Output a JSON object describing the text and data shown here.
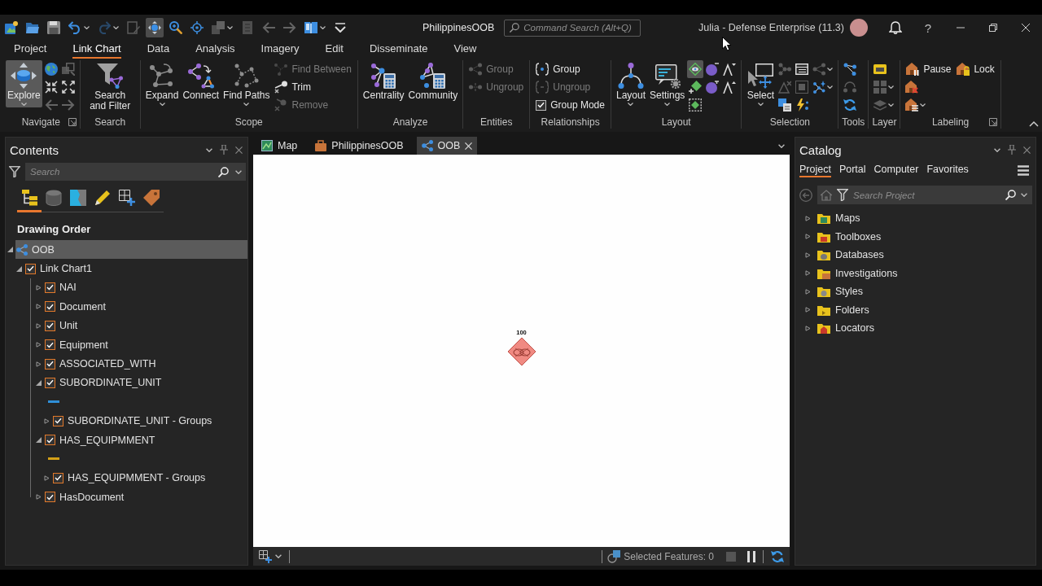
{
  "title_bar": {
    "quick_access": [
      {
        "selected": false,
        "disabled": false
      },
      {
        "selected": false,
        "disabled": false
      },
      {
        "selected": false,
        "disabled": false
      },
      {
        "selected": false,
        "disabled": false,
        "dropdown": true
      },
      {
        "selected": false,
        "disabled": true,
        "dropdown": true
      },
      {
        "selected": false,
        "disabled": true
      },
      {
        "selected": true,
        "disabled": false
      },
      {
        "selected": false,
        "disabled": false
      },
      {
        "selected": false,
        "disabled": false
      },
      {
        "selected": false,
        "disabled": true,
        "dropdown": true
      },
      {
        "selected": false,
        "disabled": true
      },
      {
        "selected": false,
        "disabled": true
      },
      {
        "selected": false,
        "disabled": true
      },
      {
        "selected": false,
        "disabled": false,
        "dropdown": true
      },
      {
        "selected": false,
        "disabled": false
      }
    ],
    "title": "PhilippinesOOB",
    "command_search": {
      "placeholder": "Command Search (Alt+Q)"
    },
    "user": "Julia - Defense Enterprise (11.3)",
    "help": "?"
  },
  "ribbon": {
    "tabs": [
      {
        "label": "Project",
        "selected": false
      },
      {
        "label": "Link Chart",
        "selected": true
      },
      {
        "label": "Data",
        "selected": false
      },
      {
        "label": "Analysis",
        "selected": false
      },
      {
        "label": "Imagery",
        "selected": false
      },
      {
        "label": "Edit",
        "selected": false
      },
      {
        "label": "Disseminate",
        "selected": false
      },
      {
        "label": "View",
        "selected": false
      }
    ],
    "groups": [
      {
        "label": "Navigate",
        "launcher": true,
        "stacks": [
          [
            {
              "kind": "large",
              "label": "Explore",
              "selected": true,
              "disabled": false,
              "dropdown": true
            }
          ],
          [
            {
              "kind": "icon",
              "selected": false,
              "disabled": false
            },
            {
              "kind": "icon",
              "selected": false,
              "disabled": false
            },
            {
              "kind": "icon",
              "selected": false,
              "disabled": true
            }
          ],
          [
            {
              "kind": "icon",
              "selected": false,
              "disabled": true
            },
            {
              "kind": "icon",
              "selected": false,
              "disabled": false
            },
            {
              "kind": "icon",
              "selected": false,
              "disabled": true
            }
          ]
        ]
      },
      {
        "label": "Search",
        "launcher": false,
        "stacks": [
          [
            {
              "kind": "large",
              "label": "Search and Filter",
              "selected": false,
              "disabled": false
            }
          ]
        ]
      },
      {
        "label": "Scope",
        "launcher": false,
        "stacks": [
          [
            {
              "kind": "large",
              "label": "Expand",
              "selected": false,
              "disabled": false,
              "dropdown": true
            }
          ],
          [
            {
              "kind": "large",
              "label": "Connect",
              "selected": false,
              "disabled": false
            }
          ],
          [
            {
              "kind": "large",
              "label": "Find Paths",
              "selected": false,
              "disabled": false,
              "dropdown": true
            }
          ],
          [
            {
              "kind": "small",
              "label": "Find Between",
              "selected": false,
              "disabled": true
            },
            {
              "kind": "small",
              "label": "Trim",
              "selected": false,
              "disabled": false
            },
            {
              "kind": "small",
              "label": "Remove",
              "selected": false,
              "disabled": true
            }
          ]
        ]
      },
      {
        "label": "Analyze",
        "launcher": false,
        "stacks": [
          [
            {
              "kind": "large",
              "label": "Centrality",
              "selected": false,
              "disabled": false
            }
          ],
          [
            {
              "kind": "large",
              "label": "Community",
              "selected": false,
              "disabled": false
            }
          ]
        ]
      },
      {
        "label": "Entities",
        "launcher": false,
        "stacks": [
          [
            {
              "kind": "small",
              "label": "Group",
              "selected": false,
              "disabled": true
            },
            {
              "kind": "small",
              "label": "Ungroup",
              "selected": false,
              "disabled": true
            }
          ]
        ]
      },
      {
        "label": "Relationships",
        "launcher": false,
        "stacks": [
          [
            {
              "kind": "small",
              "label": "Group",
              "selected": false,
              "disabled": false
            },
            {
              "kind": "small",
              "label": "Ungroup",
              "selected": false,
              "disabled": true
            },
            {
              "kind": "check",
              "label": "Group Mode",
              "checked": true
            }
          ]
        ]
      },
      {
        "label": "Layout",
        "launcher": false,
        "stacks": [
          [
            {
              "kind": "large",
              "label": "Layout",
              "selected": false,
              "disabled": false,
              "dropdown": true
            }
          ],
          [
            {
              "kind": "large",
              "label": "Settings",
              "selected": false,
              "disabled": false,
              "dropdown": true
            }
          ],
          [
            {
              "kind": "icon",
              "selected": true,
              "disabled": false
            },
            {
              "kind": "icon",
              "selected": false,
              "disabled": false
            },
            {
              "kind": "icon",
              "selected": false,
              "disabled": false
            }
          ],
          [
            {
              "kind": "icon",
              "selected": false,
              "disabled": false
            },
            {
              "kind": "icon",
              "selected": false,
              "disabled": false
            }
          ],
          [
            {
              "kind": "icon",
              "selected": false,
              "disabled": false
            },
            {
              "kind": "icon",
              "selected": false,
              "disabled": false
            }
          ]
        ]
      },
      {
        "label": "Selection",
        "launcher": false,
        "stacks": [
          [
            {
              "kind": "large",
              "label": "Select",
              "selected": false,
              "disabled": false,
              "dropdown": true
            }
          ],
          [
            {
              "kind": "icon",
              "selected": false,
              "disabled": true
            },
            {
              "kind": "icon",
              "selected": false,
              "disabled": true
            },
            {
              "kind": "icon",
              "selected": false,
              "disabled": false
            }
          ],
          [
            {
              "kind": "icon",
              "selected": false,
              "disabled": false
            },
            {
              "kind": "icon",
              "selected": false,
              "disabled": true
            },
            {
              "kind": "icon",
              "selected": false,
              "disabled": false
            }
          ],
          [
            {
              "kind": "icon",
              "selected": false,
              "disabled": true,
              "dropdown": true
            },
            {
              "kind": "icon",
              "selected": false,
              "disabled": false,
              "dropdown": true
            }
          ]
        ]
      },
      {
        "label": "Tools",
        "launcher": false,
        "stacks": [
          [
            {
              "kind": "icon",
              "selected": false,
              "disabled": false
            },
            {
              "kind": "icon",
              "selected": false,
              "disabled": true
            },
            {
              "kind": "icon",
              "selected": false,
              "disabled": false
            }
          ]
        ]
      },
      {
        "label": "Layer",
        "launcher": false,
        "stacks": [
          [
            {
              "kind": "icon",
              "selected": false,
              "disabled": false
            },
            {
              "kind": "icon",
              "selected": false,
              "disabled": true,
              "dropdown": true
            },
            {
              "kind": "icon",
              "selected": false,
              "disabled": true,
              "dropdown": true
            }
          ]
        ]
      },
      {
        "label": "Labeling",
        "launcher": true,
        "stacks": [
          [
            {
              "kind": "small",
              "label": "Pause",
              "selected": false,
              "disabled": false
            },
            {
              "kind": "icon",
              "selected": false,
              "disabled": false
            },
            {
              "kind": "icon",
              "selected": false,
              "disabled": false,
              "dropdown": true
            }
          ],
          [
            {
              "kind": "small",
              "label": "Lock",
              "selected": false,
              "disabled": false
            }
          ]
        ]
      }
    ]
  },
  "contents": {
    "title": "Contents",
    "search": {
      "placeholder": "Search"
    },
    "views": [
      {
        "selected": true
      },
      {
        "selected": false
      },
      {
        "selected": false
      },
      {
        "selected": false
      },
      {
        "selected": false
      },
      {
        "selected": false
      }
    ],
    "heading": "Drawing Order",
    "tree": [
      {
        "kind": "map",
        "label": "OOB",
        "selected": true,
        "expanded": true,
        "children": [
          {
            "kind": "layer",
            "label": "Link Chart1",
            "checked": true,
            "selected": false,
            "expanded": true,
            "children": [
              {
                "kind": "layer",
                "label": "NAI",
                "checked": true,
                "selected": false,
                "expanded": false
              },
              {
                "kind": "layer",
                "label": "Document",
                "checked": true,
                "selected": false,
                "expanded": false
              },
              {
                "kind": "layer",
                "label": "Unit",
                "checked": true,
                "selected": false,
                "expanded": false
              },
              {
                "kind": "layer",
                "label": "Equipment",
                "checked": true,
                "selected": false,
                "expanded": false
              },
              {
                "kind": "layer",
                "label": "ASSOCIATED_WITH",
                "checked": true,
                "selected": false,
                "expanded": false
              },
              {
                "kind": "layer",
                "label": "SUBORDINATE_UNIT",
                "checked": true,
                "selected": false,
                "expanded": true,
                "children": [
                  {
                    "kind": "symbol",
                    "color": "#2f8fd8"
                  },
                  {
                    "kind": "layer",
                    "label": "SUBORDINATE_UNIT - Groups",
                    "checked": true,
                    "selected": false,
                    "expanded": false
                  }
                ]
              },
              {
                "kind": "layer",
                "label": "HAS_EQUIPMMENT",
                "checked": true,
                "selected": false,
                "expanded": true,
                "children": [
                  {
                    "kind": "symbol",
                    "color": "#d4a017"
                  },
                  {
                    "kind": "layer",
                    "label": "HAS_EQUIPMMENT - Groups",
                    "checked": true,
                    "selected": false,
                    "expanded": false
                  }
                ]
              },
              {
                "kind": "layer",
                "label": "HasDocument",
                "checked": true,
                "selected": false,
                "expanded": false
              }
            ]
          }
        ]
      }
    ]
  },
  "view": {
    "tabs": [
      {
        "label": "Map",
        "selected": false
      },
      {
        "label": "PhilippinesOOB",
        "selected": false
      },
      {
        "label": "OOB",
        "selected": true
      }
    ],
    "link_chart": {
      "nodes": [
        {
          "label": "100"
        }
      ]
    },
    "status_bar": {
      "selected_features": "Selected Features: 0"
    }
  },
  "catalog": {
    "title": "Catalog",
    "tabs": [
      {
        "label": "Project",
        "selected": true
      },
      {
        "label": "Portal",
        "selected": false
      },
      {
        "label": "Computer",
        "selected": false
      },
      {
        "label": "Favorites",
        "selected": false
      }
    ],
    "search": {
      "placeholder": "Search Project"
    },
    "items": [
      {
        "label": "Maps",
        "selected": false,
        "expanded": false
      },
      {
        "label": "Toolboxes",
        "selected": false,
        "expanded": false
      },
      {
        "label": "Databases",
        "selected": false,
        "expanded": false
      },
      {
        "label": "Investigations",
        "selected": false,
        "expanded": false
      },
      {
        "label": "Styles",
        "selected": false,
        "expanded": false
      },
      {
        "label": "Folders",
        "selected": false,
        "expanded": false
      },
      {
        "label": "Locators",
        "selected": false,
        "expanded": false
      }
    ]
  }
}
